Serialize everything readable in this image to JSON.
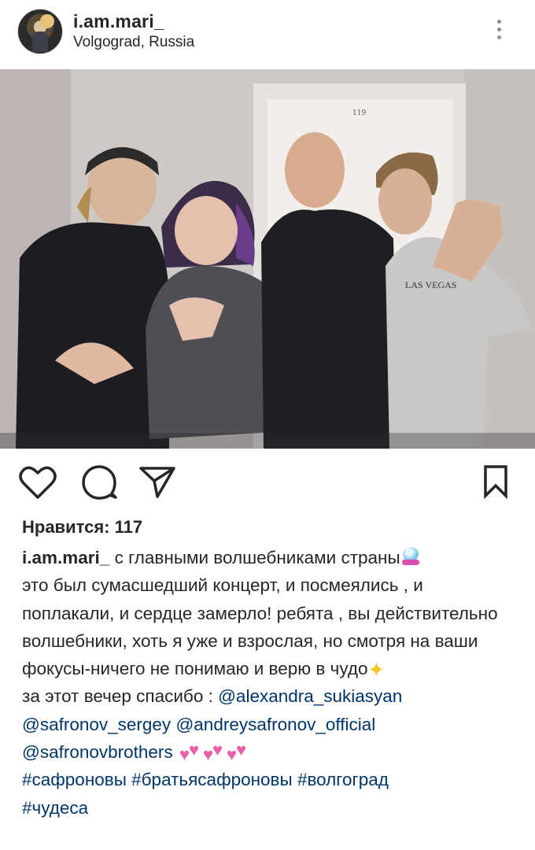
{
  "post": {
    "username": "i.am.mari_",
    "location": "Volgograd, Russia",
    "door_number": "119",
    "shirt_text": "LAS VEGAS"
  },
  "actions": {
    "like_icon": "heart-icon",
    "comment_icon": "comment-icon",
    "share_icon": "paper-plane-icon",
    "save_icon": "bookmark-icon"
  },
  "likes": {
    "text": "Нравится: 117"
  },
  "caption": {
    "author": "i.am.mari_",
    "line1": " с главными волшебниками страны",
    "line2": "это был сумасшедший концерт, и посмеялись , и поплакали, и сердце замерло! ребята , вы действительно волшебники, хоть я уже и взрослая, но смотря на ваши фокусы-ничего не понимаю и верю в чудо",
    "thanks": "за этот вечер спасибо : ",
    "mentions": [
      "@alexandra_sukiasyan",
      "@safronov_sergey",
      "@andreysafronov_official",
      "@safronovbrothers"
    ],
    "hashtags": [
      "#сафроновы",
      "#братьясафроновы",
      "#волгоград",
      "#чудеса"
    ]
  },
  "colors": {
    "link": "#003569",
    "text": "#262626",
    "icon": "#262626"
  }
}
